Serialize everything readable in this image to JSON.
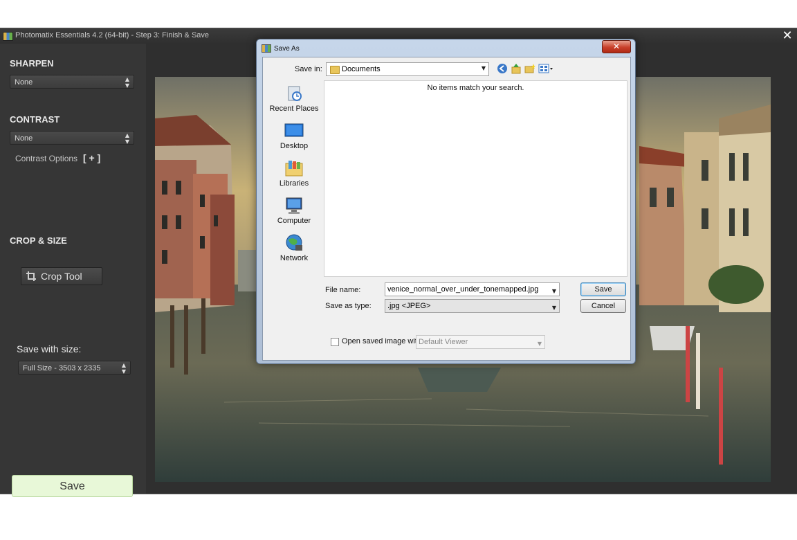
{
  "app": {
    "title": "Photomatix Essentials 4.2 (64-bit) - Step 3: Finish & Save",
    "close_glyph": "✕"
  },
  "sidebar": {
    "sharpen": {
      "title": "SHARPEN",
      "value": "None"
    },
    "contrast": {
      "title": "CONTRAST",
      "value": "None",
      "options_label": "Contrast Options",
      "options_toggle": "[ + ]"
    },
    "crop": {
      "title": "CROP & SIZE",
      "button_label": "Crop Tool"
    },
    "size": {
      "label": "Save with size:",
      "value": "Full Size - 3503 x 2335"
    },
    "save_label": "Save"
  },
  "dialog": {
    "title": "Save As",
    "close_glyph": "✕",
    "save_in_label": "Save in:",
    "save_in_value": "Documents",
    "empty_message": "No items match your search.",
    "places": [
      {
        "label": "Recent Places",
        "icon": "recent-places-icon"
      },
      {
        "label": "Desktop",
        "icon": "desktop-icon"
      },
      {
        "label": "Libraries",
        "icon": "libraries-icon"
      },
      {
        "label": "Computer",
        "icon": "computer-icon"
      },
      {
        "label": "Network",
        "icon": "network-icon"
      }
    ],
    "file_name_label": "File name:",
    "file_name_value": "venice_normal_over_under_tonemapped.jpg",
    "save_type_label": "Save as type:",
    "save_type_value": ".jpg <JPEG>",
    "open_saved_label": "Open saved image with:",
    "open_saved_checked": false,
    "viewer_value": "Default Viewer",
    "save_button": "Save",
    "cancel_button": "Cancel"
  },
  "colors": {
    "app_bg": "#2e2e2e",
    "sidebar_bg": "#363636",
    "save_button_bg": "#e8f8d8",
    "dialog_frame": "#c6d6ea",
    "dialog_close": "#c8402a"
  }
}
